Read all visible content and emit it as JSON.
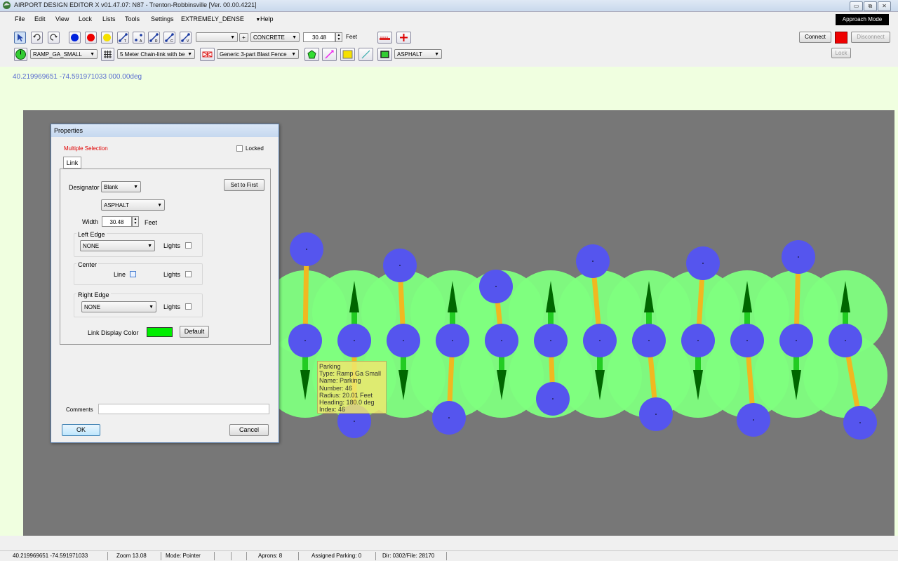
{
  "window": {
    "title": "AIRPORT DESIGN EDITOR X  v01.47.07: N87 - Trenton-Robbinsville [Ver. 00.00.4221]",
    "controls": [
      "minimize-icon",
      "restore-icon",
      "close-icon"
    ]
  },
  "menu": {
    "items": [
      "File",
      "Edit",
      "View",
      "Lock",
      "Lists",
      "Tools",
      "Settings"
    ],
    "density": "EXTREMELY_DENSE",
    "help": "Help"
  },
  "approach_mode": "Approach Mode",
  "toolbar": {
    "surface": "CONCRETE",
    "width_value": "30.48",
    "width_unit": "Feet",
    "ramp_type": "RAMP_GA_SMALL",
    "fence_type": "5 Meter Chain-link with be",
    "blast_fence": "Generic 3-part Blast Fence",
    "paint_surface": "ASPHALT",
    "blank_dropdown": ""
  },
  "connection": {
    "connect": "Connect",
    "disconnect": "Disconnect",
    "lock": "Lock",
    "status_color": "#ee0000"
  },
  "coords": "40.219969651   -74.591971033 000.00deg",
  "dialog": {
    "title": "Properties",
    "multiple_selection": "Multiple Selection",
    "locked": "Locked",
    "tab": "Link",
    "designator_label": "Designator",
    "designator": "Blank",
    "set_to_first": "Set to First",
    "surface": "ASPHALT",
    "width_label": "Width",
    "width": "30.48",
    "width_unit": "Feet",
    "left_edge_label": "Left Edge",
    "left_edge": "NONE",
    "lights": "Lights",
    "center_label": "Center",
    "line": "Line",
    "right_edge_label": "Right Edge",
    "right_edge": "NONE",
    "link_color_label": "Link Display Color",
    "link_color": "#00ee00",
    "default": "Default",
    "comments_label": "Comments",
    "comments": "",
    "ok": "OK",
    "cancel": "Cancel"
  },
  "tooltip": {
    "lines": [
      "Parking",
      "Type: Ramp Ga Small",
      "Name: Parking",
      "Number:  46",
      "Radius: 20.01 Feet",
      "Heading: 180.0 deg",
      "Index: 46"
    ]
  },
  "status": {
    "coords": "40.219969651  -74.591971033",
    "zoom": "Zoom 13.08",
    "mode": "Mode: Pointer",
    "aprons": "Aprons: 8",
    "assigned": "Assigned Parking: 0",
    "dir": "Dir: 0302/File: 28170"
  },
  "colors": {
    "node": "#5555ee",
    "parking_circle": "#80ff80",
    "link": "#f0b820",
    "arrow": "#006600",
    "canvas": "#777777"
  }
}
